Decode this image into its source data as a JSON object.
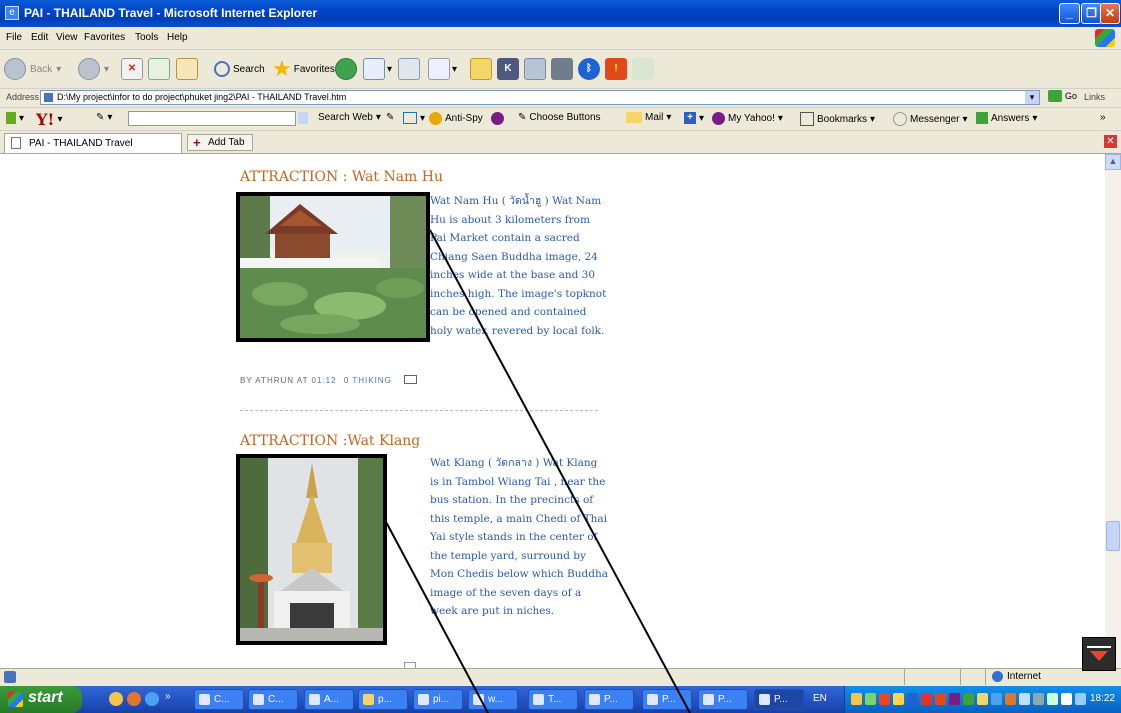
{
  "window": {
    "title": "PAI - THAILAND Travel - Microsoft Internet Explorer"
  },
  "menu": [
    "File",
    "Edit",
    "View",
    "Favorites",
    "Tools",
    "Help"
  ],
  "toolbar": {
    "back": "Back",
    "search": "Search",
    "favorites": "Favorites"
  },
  "address": {
    "label": "Address",
    "value": "D:\\My project\\infor to do project\\phuket jing2\\PAI - THAILAND Travel.htm",
    "go": "Go",
    "links": "Links"
  },
  "yahoo": {
    "search_web": "Search Web",
    "anti_spy": "Anti-Spy",
    "choose_buttons": "Choose Buttons",
    "mail": "Mail",
    "my_yahoo": "My Yahoo!",
    "bookmarks": "Bookmarks",
    "messenger": "Messenger",
    "answers": "Answers"
  },
  "tabs": {
    "active": "PAI - THAILAND Travel",
    "add": "Add Tab"
  },
  "posts": [
    {
      "title": "ATTRACTION : Wat Nam Hu",
      "text": "Wat Nam Hu ( วัดน้ำฮู ) Wat Nam Hu is about 3 kilometers from Pai Market contain a sacred Chiang Saen Buddha image, 24 inches wide at the base and 30 inches high. The image's topknot can be opened and contained holy water, revered by local folk.",
      "byline_prefix": "BY ATHRUN AT",
      "time": "01:12",
      "comments": "0 THIKING"
    },
    {
      "title": "ATTRACTION :Wat Klang",
      "text": "Wat Klang ( วัดกลาง ) Wat Klang is in Tambol Wiang Tai , near the bus station. In the precincts of this temple, a main Chedi of Thai Yai style stands in the center of the temple yard, surround by Mon Chedis below which Buddha image of the seven days of a week are put in niches."
    }
  ],
  "status": {
    "zone": "Internet"
  },
  "taskbar": {
    "start": "start",
    "tasks": [
      "C...",
      "C...",
      "A...",
      "p...",
      "pi...",
      "w...",
      "T...",
      "P...",
      "P...",
      "P...",
      "P..."
    ],
    "lang": "EN",
    "clock": "18:22"
  }
}
